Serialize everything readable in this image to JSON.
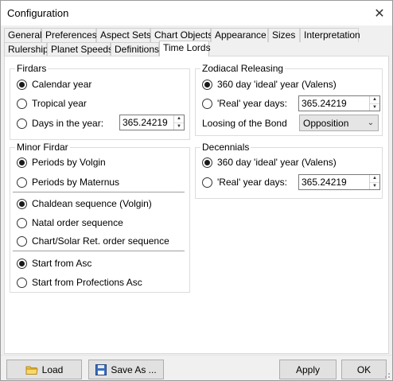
{
  "window": {
    "title": "Configuration",
    "close": "✕"
  },
  "tabs_row1": [
    "General",
    "Preferences",
    "Aspect Sets",
    "Chart Objects",
    "Appearance",
    "Sizes",
    "Interpretation"
  ],
  "tabs_row2": [
    "Rulership",
    "Planet Speeds",
    "Definitions",
    "Time Lords"
  ],
  "active_tab": "Time Lords",
  "firdars": {
    "title": "Firdars",
    "options": [
      "Calendar year",
      "Tropical year",
      "Days in the year:"
    ],
    "selected": 0,
    "days_value": "365.24219"
  },
  "minor_firdar": {
    "title": "Minor Firdar",
    "periods": [
      "Periods by Volgin",
      "Periods by Maternus"
    ],
    "periods_selected": 0,
    "sequences": [
      "Chaldean sequence (Volgin)",
      "Natal order sequence",
      "Chart/Solar Ret. order sequence"
    ],
    "sequences_selected": 0,
    "start": [
      "Start from Asc",
      "Start from Profections Asc"
    ],
    "start_selected": 0
  },
  "zodiacal_releasing": {
    "title": "Zodiacal Releasing",
    "options": [
      "360 day 'ideal' year (Valens)",
      "'Real' year days:"
    ],
    "selected": 0,
    "days_value": "365.24219",
    "loosing_label": "Loosing of the Bond",
    "loosing_value": "Opposition"
  },
  "decennials": {
    "title": "Decennials",
    "options": [
      "360 day 'ideal' year (Valens)",
      "'Real' year days:"
    ],
    "selected": 0,
    "days_value": "365.24219"
  },
  "buttons": {
    "load": "Load",
    "save_as": "Save As ...",
    "apply": "Apply",
    "ok": "OK"
  },
  "icons": {
    "load": "folder-icon",
    "save_as": "floppy-disk-icon"
  }
}
